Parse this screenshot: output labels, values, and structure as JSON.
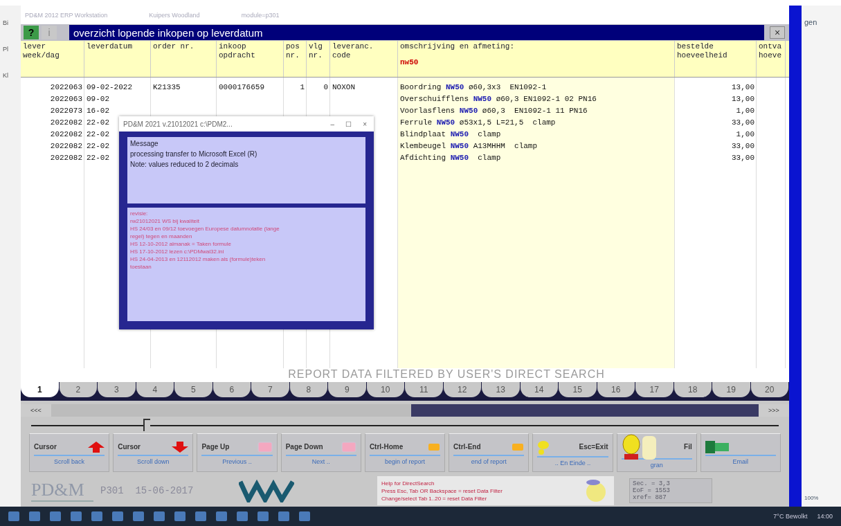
{
  "outer_window": {
    "title_parts": [
      "PD&M 2012 ERP Workstation",
      "Kuipers Woodland",
      "module=p301"
    ]
  },
  "background_app": {
    "left_labels": [
      "Bi",
      "Pl",
      "Kl"
    ],
    "right_label": "gen",
    "zoom": "100%"
  },
  "dialog": {
    "help_button": "?",
    "info_button": "i",
    "title": "overzicht lopende inkopen op leverdatum",
    "close": "×"
  },
  "table": {
    "columns": [
      {
        "lines": [
          "lever",
          "week/dag"
        ]
      },
      {
        "lines": [
          "leverdatum"
        ]
      },
      {
        "lines": [
          "order nr."
        ]
      },
      {
        "lines": [
          "inkoop",
          "opdracht"
        ]
      },
      {
        "lines": [
          "pos",
          "nr."
        ]
      },
      {
        "lines": [
          "vlg",
          "nr."
        ]
      },
      {
        "lines": [
          "leveranc.",
          "code"
        ]
      },
      {
        "lines": [
          "omschrijving en afmeting:"
        ],
        "filter": "nw50"
      },
      {
        "lines": [
          "bestelde",
          "hoeveelheid"
        ]
      },
      {
        "lines": [
          "ontva",
          "hoeve"
        ]
      }
    ],
    "rows": [
      {
        "cells": [
          "2022063",
          "09-02-2022",
          "K21335",
          "0000176659",
          "1",
          "0",
          "NOXON",
          "Boordring **NW50** ø60,3x3  EN1092-1",
          "13,00",
          ""
        ]
      },
      {
        "cells": [
          "2022063",
          "09-02",
          "",
          "",
          "",
          "",
          "",
          "Overschuifflens **NW50** ø60,3 EN1092-1 02 PN16",
          "13,00",
          ""
        ]
      },
      {
        "cells": [
          "2022073",
          "16-02",
          "",
          "",
          "",
          "",
          "",
          "Voorlasflens **NW50** ø60,3  EN1092-1 11 PN16",
          "1,00",
          ""
        ]
      },
      {
        "cells": [
          "2022082",
          "22-02",
          "",
          "",
          "",
          "",
          "",
          "Ferrule **NW50** ø53x1,5 L=21,5  clamp",
          "33,00",
          ""
        ]
      },
      {
        "cells": [
          "2022082",
          "22-02",
          "",
          "",
          "",
          "",
          "",
          "Blindplaat **NW50**  clamp",
          "1,00",
          ""
        ]
      },
      {
        "cells": [
          "2022082",
          "22-02",
          "",
          "",
          "",
          "",
          "",
          "Klembeugel **NW50** A13MHHM  clamp",
          "33,00",
          ""
        ]
      },
      {
        "cells": [
          "2022082",
          "22-02",
          "",
          "",
          "",
          "",
          "",
          "Afdichting **NW50**  clamp",
          "33,00",
          ""
        ]
      }
    ]
  },
  "message_window": {
    "title": "PD&M 2021 v.21012021 c:\\PDM2...",
    "controls": [
      "–",
      "☐",
      "×"
    ],
    "heading": "Message",
    "lines": [
      "processing transfer to Microsoft Excel (R)",
      "Note: values reduced to 2 decimals"
    ],
    "log": [
      "revisie:",
      "rw21012021 WS bij kwaliteit",
      "HS 24/03 en 09/12 toevoegen Europese datumnotatie (lange",
      "regel) tegen en maanden",
      "HS 12-10-2012 almanak = Taken formule",
      "HS 17-10-2012 lezen c:\\PDMwal32.ini",
      "HS 24-04-2013 en 12112012 maken als (formule)teken",
      "toestaan"
    ]
  },
  "filter_notice": "REPORT DATA FILTERED BY USER'S DIRECT SEARCH",
  "tabs": [
    {
      "label": "1",
      "selected": true
    },
    {
      "label": "2",
      "selected": false
    },
    {
      "label": "3",
      "selected": false
    },
    {
      "label": "4",
      "selected": false
    },
    {
      "label": "5",
      "selected": false
    },
    {
      "label": "6",
      "selected": false
    },
    {
      "label": "7",
      "selected": false
    },
    {
      "label": "8",
      "selected": false
    },
    {
      "label": "9",
      "selected": false
    },
    {
      "label": "10",
      "selected": false
    },
    {
      "label": "11",
      "selected": false
    },
    {
      "label": "12",
      "selected": false
    },
    {
      "label": "13",
      "selected": false
    },
    {
      "label": "14",
      "selected": false
    },
    {
      "label": "15",
      "selected": false
    },
    {
      "label": "16",
      "selected": false
    },
    {
      "label": "17",
      "selected": false
    },
    {
      "label": "18",
      "selected": false
    },
    {
      "label": "19",
      "selected": false
    },
    {
      "label": "20",
      "selected": false
    }
  ],
  "scrollbar": {
    "back": "<<<",
    "forward": ">>>"
  },
  "slider": {
    "level": 0.15
  },
  "buttons": [
    {
      "label": "Cursor",
      "sublabel": "Scroll back",
      "kind": "up"
    },
    {
      "label": "Cursor",
      "sublabel": "Scroll down",
      "kind": "down"
    },
    {
      "label": "Page Up",
      "sublabel": "Previous ..",
      "kind": "pink-key"
    },
    {
      "label": "Page Down",
      "sublabel": "Next ..",
      "kind": "pink-key"
    },
    {
      "label": "Ctrl-Home",
      "sublabel": "begin of report",
      "kind": "orange-key"
    },
    {
      "label": "Ctrl-End",
      "sublabel": "end of report",
      "kind": "orange-key"
    },
    {
      "label": "Esc=Exit",
      "sublabel": ".. En Einde ..",
      "kind": "exit"
    },
    {
      "label": "Fil",
      "sublabel": "gran",
      "kind": "mascot"
    },
    {
      "sublabel": "Email",
      "kind": "excel"
    }
  ],
  "footer": {
    "logo": "PD&M",
    "module": "P301  15-06-2017",
    "help": [
      "Help for DirectSearch",
      "Press Esc, Tab OR Backspace = reset Data Filter",
      "Change/select Tab 1..20 = reset Data Filter"
    ],
    "stats": [
      "Sec. = 3,3",
      "EoF = 1553",
      "xref= 887"
    ]
  },
  "taskbar": {
    "weather": "7°C Bewolkt",
    "time": "14:00"
  }
}
